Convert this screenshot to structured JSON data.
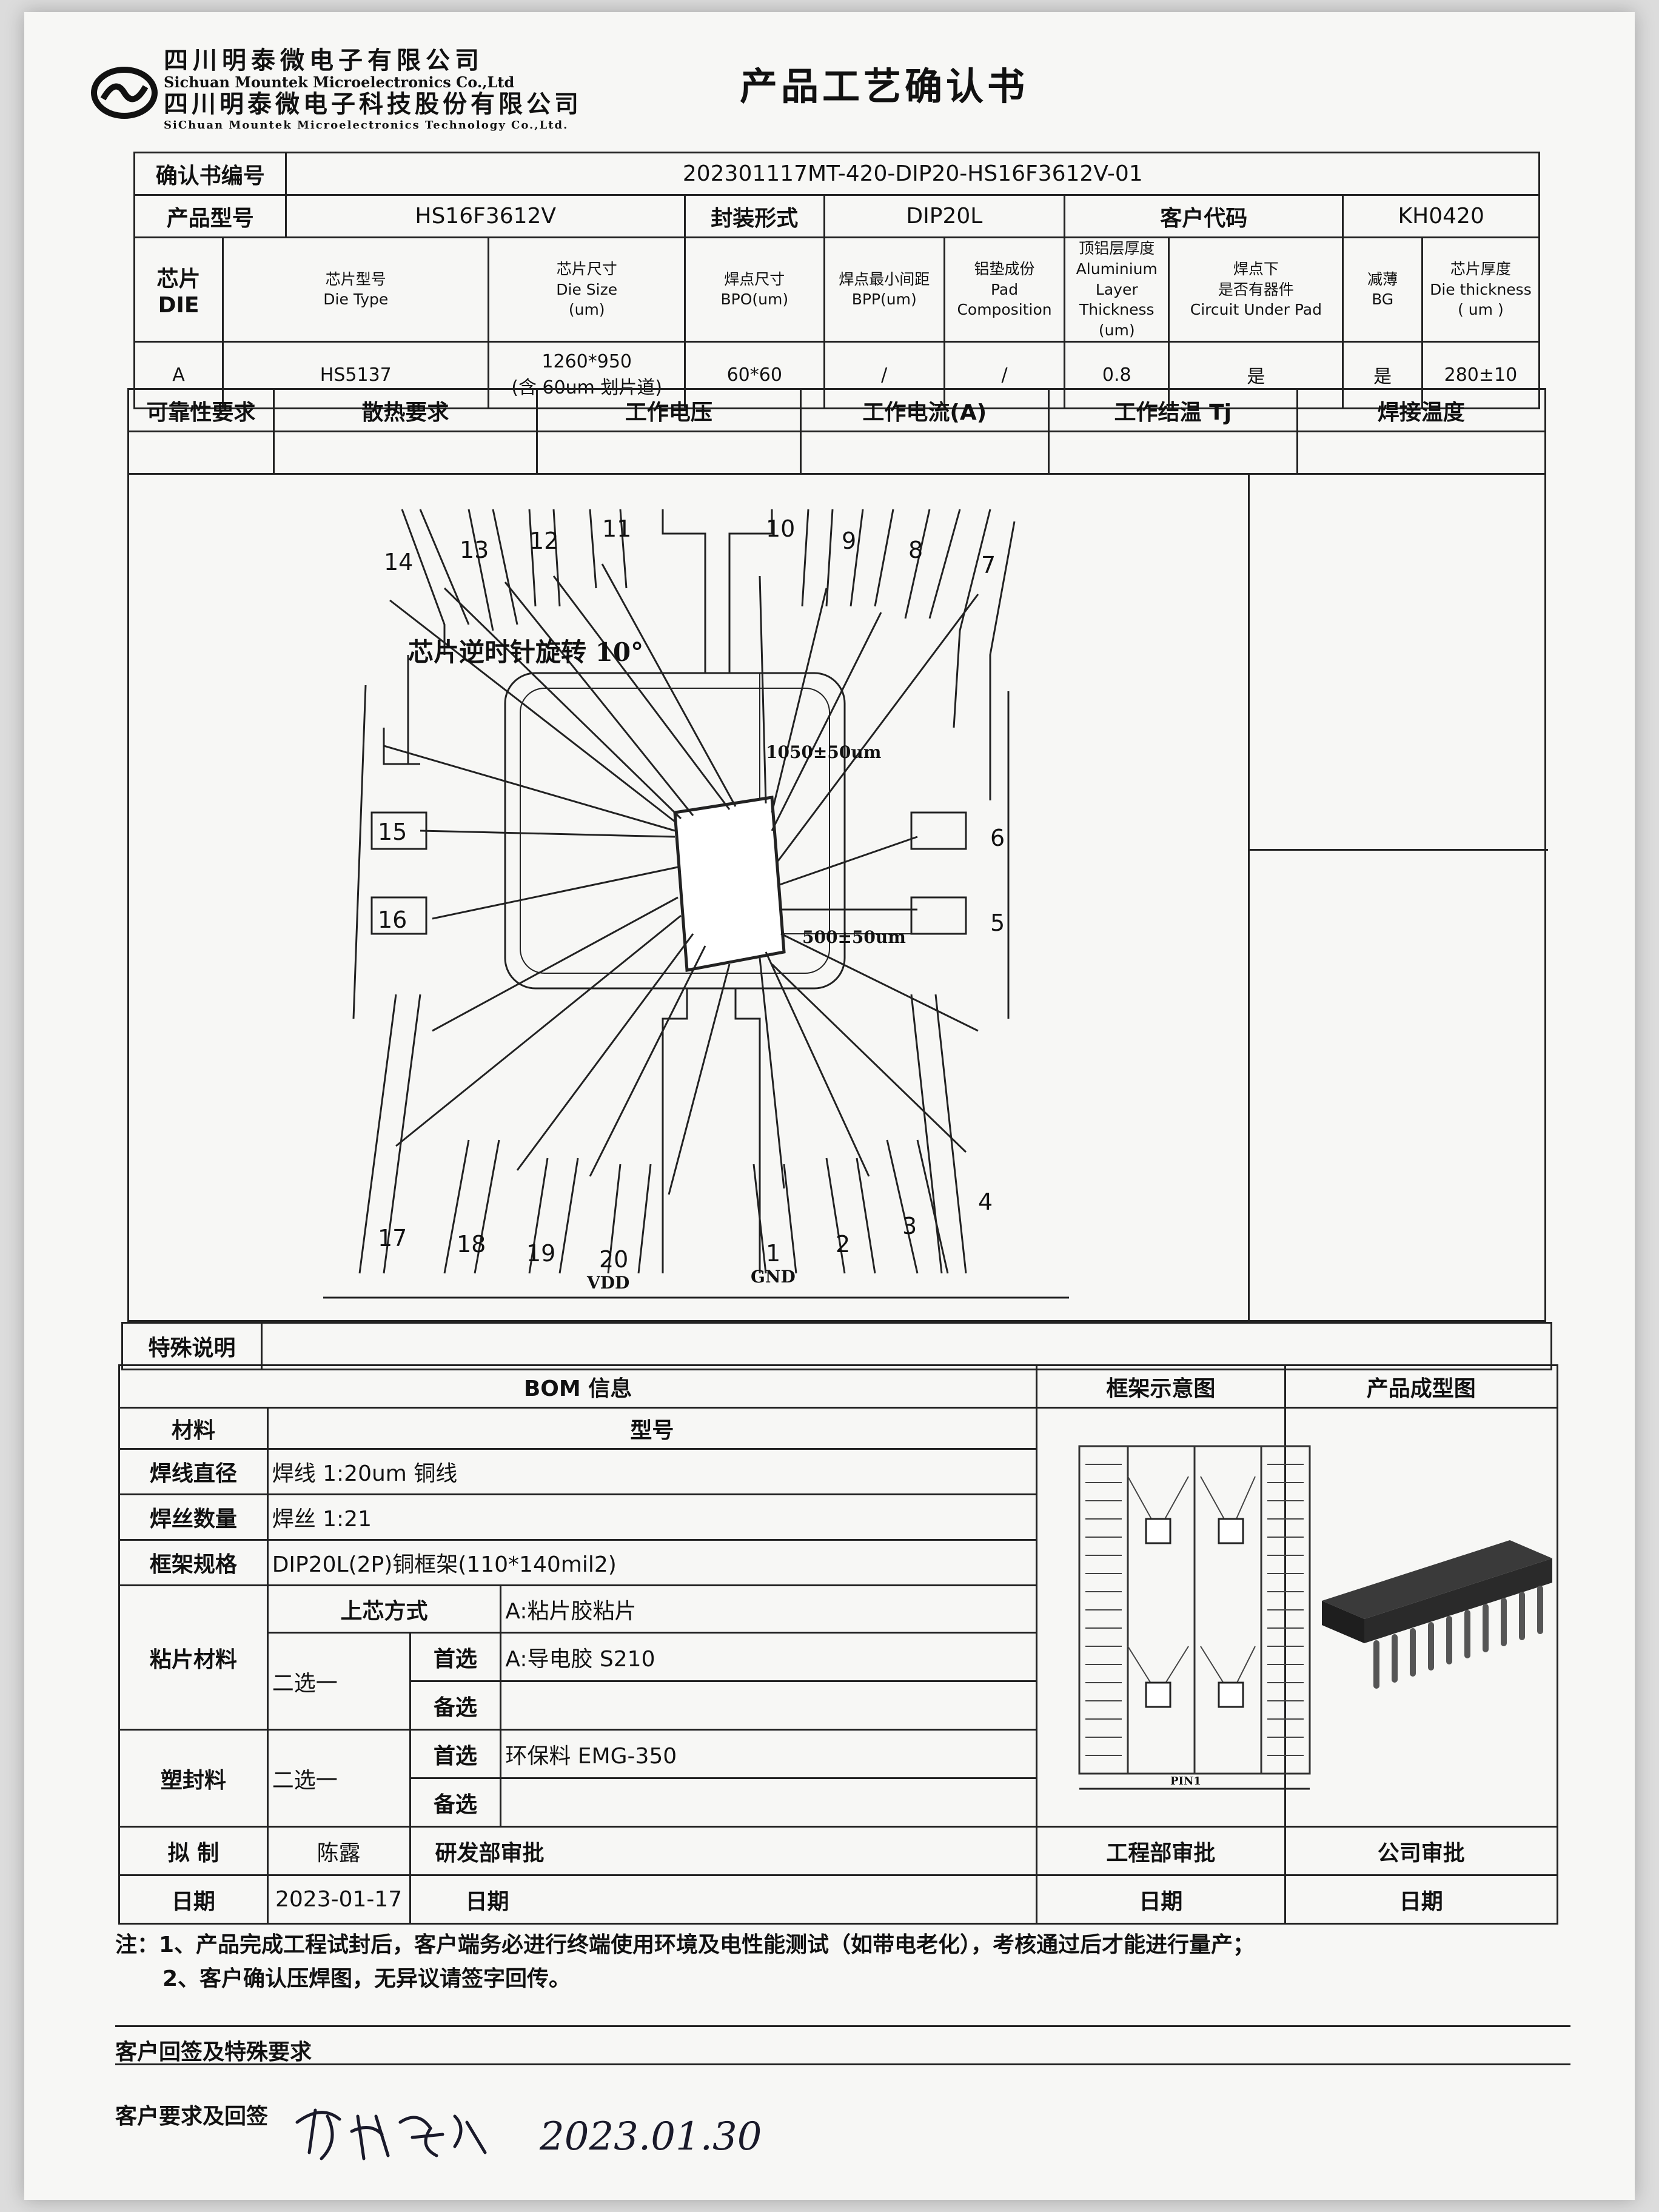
{
  "header": {
    "company_cn_1": "四川明泰微电子有限公司",
    "company_en_1": "Sichuan Mountek Microelectronics Co.,Ltd",
    "company_cn_2": "四川明泰微电子科技股份有限公司",
    "company_en_2": "SiChuan Mountek Microelectronics Technology Co.,Ltd.",
    "title": "产品工艺确认书"
  },
  "info": {
    "confirm_no_label": "确认书编号",
    "confirm_no": "202301117MT-420-DIP20-HS16F3612V-01",
    "model_label": "产品型号",
    "model": "HS16F3612V",
    "package_label": "封装形式",
    "package": "DIP20L",
    "customer_code_label": "客户代码",
    "customer_code": "KH0420"
  },
  "die": {
    "label": "芯片DIE",
    "headers": [
      {
        "cn": "芯片型号",
        "en": "Die Type",
        "unit": ""
      },
      {
        "cn": "芯片尺寸",
        "en": "Die Size",
        "unit": "(um)"
      },
      {
        "cn": "焊点尺寸",
        "en": "BPO(um)",
        "unit": ""
      },
      {
        "cn": "焊点最小间距",
        "en": "BPP(um)",
        "unit": ""
      },
      {
        "cn": "铝垫成份",
        "en": "Pad",
        "unit": "Composition"
      },
      {
        "cn": "顶铝层厚度",
        "en": "Aluminium Layer",
        "unit": "Thickness (um)"
      },
      {
        "cn": "焊点下",
        "en": "是否有器件",
        "unit": "Circuit Under Pad"
      },
      {
        "cn": "减薄",
        "en": "BG",
        "unit": ""
      },
      {
        "cn": "芯片厚度",
        "en": "Die thickness",
        "unit": "( um )"
      }
    ],
    "row": {
      "id": "A",
      "type": "HS5137",
      "size": "1260*950",
      "size_note": "(含 60um 划片道)",
      "bpo": "60*60",
      "bpp": "/",
      "pad": "/",
      "al_thickness": "0.8",
      "circuit_under_pad": "是",
      "bg": "是",
      "thickness": "280±10"
    }
  },
  "requirements": {
    "headers": [
      "可靠性要求",
      "散热要求",
      "工作电压",
      "工作电流(A)",
      "工作结温 Tj",
      "焊接温度"
    ],
    "values": [
      "",
      "",
      "",
      "",
      "",
      ""
    ]
  },
  "bonding_diagram": {
    "rotation_note": "芯片逆时针旋转 10°",
    "dim_vertical": "1050±50um",
    "dim_horizontal": "500±50um",
    "pins_top": [
      "14",
      "13",
      "12",
      "11",
      "10",
      "9",
      "8",
      "7"
    ],
    "pins_left": [
      "15",
      "16"
    ],
    "pins_right": [
      "6",
      "5"
    ],
    "pins_bottom": [
      "17",
      "18",
      "19",
      "20",
      "1",
      "2",
      "3",
      "4"
    ],
    "vdd_label": "VDD",
    "gnd_label": "GND"
  },
  "special": {
    "label": "特殊说明",
    "value": ""
  },
  "bom": {
    "title": "BOM 信息",
    "frame_diagram_title": "框架示意图",
    "product_image_title": "产品成型图",
    "col_material": "材料",
    "col_model": "型号",
    "wire_diameter_label": "焊线直径",
    "wire_diameter": "焊线 1:20um 铜线",
    "wire_count_label": "焊丝数量",
    "wire_count": "焊丝 1:21",
    "frame_spec_label": "框架规格",
    "frame_spec": "DIP20L(2P)铜框架(110*140mil2)",
    "die_attach_label": "粘片材料",
    "attach_method_label": "上芯方式",
    "attach_method": "A:粘片胶粘片",
    "choose_one": "二选一",
    "preferred_label": "首选",
    "alternate_label": "备选",
    "attach_preferred": "A:导电胶  S210",
    "attach_alternate": "",
    "mold_label": "塑封料",
    "mold_preferred": "环保料  EMG-350",
    "mold_alternate": "",
    "frame_pin_label": "PIN1"
  },
  "approval": {
    "drafted_label": "拟  制",
    "drafted_by": "陈露",
    "rd_label": "研发部审批",
    "rd_value": "",
    "eng_label": "工程部审批",
    "eng_value": "",
    "company_label": "公司审批",
    "company_value": "",
    "date_label": "日期",
    "date1": "2023-01-17",
    "date2": "",
    "date3": "",
    "date4": ""
  },
  "notes": {
    "line1": "注：1、产品完成工程试封后，客户端务必进行终端使用环境及电性能测试（如带电老化），考核通过后才能进行量产；",
    "line2": "2、客户确认压焊图，无异议请签字回传。"
  },
  "reply": {
    "section_label": "客户回签及特殊要求",
    "reply_label": "客户要求及回签",
    "signature_date": "2023.01.30"
  }
}
